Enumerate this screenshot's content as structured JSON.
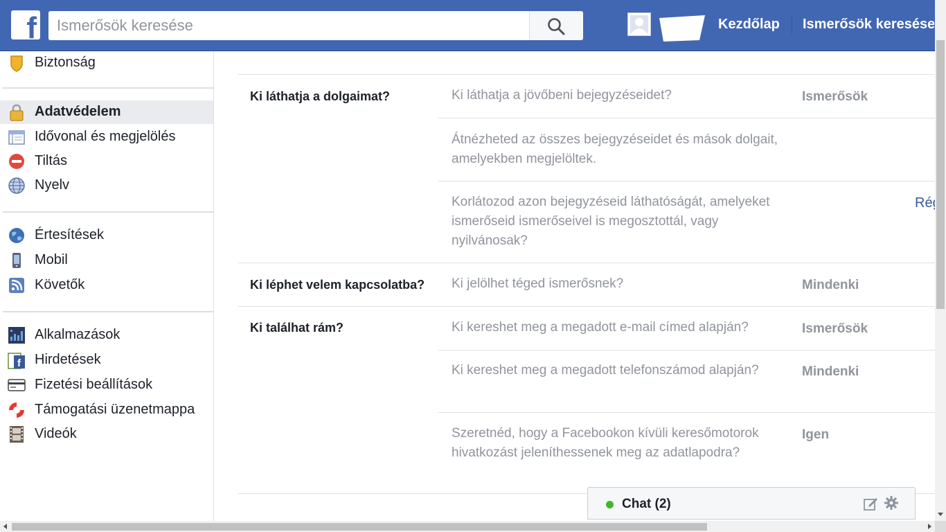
{
  "header": {
    "logo_letter": "f",
    "search_placeholder": "Ismerősök keresése",
    "nav": {
      "home": "Kezdőlap",
      "find_friends": "Ismerősök keresése"
    }
  },
  "sidebar": {
    "items": [
      {
        "label": "Biztonság",
        "icon": "shield-icon"
      },
      {
        "label": "Adatvédelem",
        "icon": "lock-icon",
        "active": true
      },
      {
        "label": "Idővonal és megjelölés",
        "icon": "timeline-icon"
      },
      {
        "label": "Tiltás",
        "icon": "block-icon"
      },
      {
        "label": "Nyelv",
        "icon": "globe-icon"
      },
      {
        "label": "Értesítések",
        "icon": "notifications-globe-icon"
      },
      {
        "label": "Mobil",
        "icon": "mobile-icon"
      },
      {
        "label": "Követők",
        "icon": "rss-icon"
      },
      {
        "label": "Alkalmazások",
        "icon": "apps-icon"
      },
      {
        "label": "Hirdetések",
        "icon": "ads-icon"
      },
      {
        "label": "Fizetési beállítások",
        "icon": "credit-card-icon"
      },
      {
        "label": "Támogatási üzenetmappa",
        "icon": "lifebuoy-icon"
      },
      {
        "label": "Videók",
        "icon": "film-icon"
      }
    ]
  },
  "privacy": {
    "sections": [
      {
        "heading": "Ki láthatja a dolgaimat?",
        "rows": [
          {
            "question": "Ki láthatja a jövőbeni bejegyzéseidet?",
            "value": "Ismerősök"
          },
          {
            "question": "Átnézheted az összes bejegyzéseidet és mások dolgait, amelyekben megjelöltek.",
            "value": ""
          },
          {
            "question": "Korlátozod azon bejegyzéseid láthatóságát, amelyeket ismerőseid ismerőseivel is megosztottál, vagy nyilvánosak?",
            "value": "",
            "link": "Rég"
          }
        ]
      },
      {
        "heading": "Ki léphet velem kapcsolatba?",
        "rows": [
          {
            "question": "Ki jelölhet téged ismerősnek?",
            "value": "Mindenki"
          }
        ]
      },
      {
        "heading": "Ki találhat rám?",
        "rows": [
          {
            "question": "Ki kereshet meg a megadott e-mail címed alapján?",
            "value": "Ismerősök"
          },
          {
            "question": "Ki kereshet meg a megadott telefonszámod alapján?",
            "value": "Mindenki"
          },
          {
            "question": "Szeretnéd, hogy a Facebookon kívüli keresőmotorok hivatkozást jeleníthessenek meg az adatlapodra?",
            "value": "Igen"
          }
        ]
      }
    ]
  },
  "chat": {
    "label": "Chat (2)",
    "status_color": "#42b72a"
  },
  "colors": {
    "brand": "#4267b2",
    "link": "#365899",
    "muted": "#90949c"
  }
}
